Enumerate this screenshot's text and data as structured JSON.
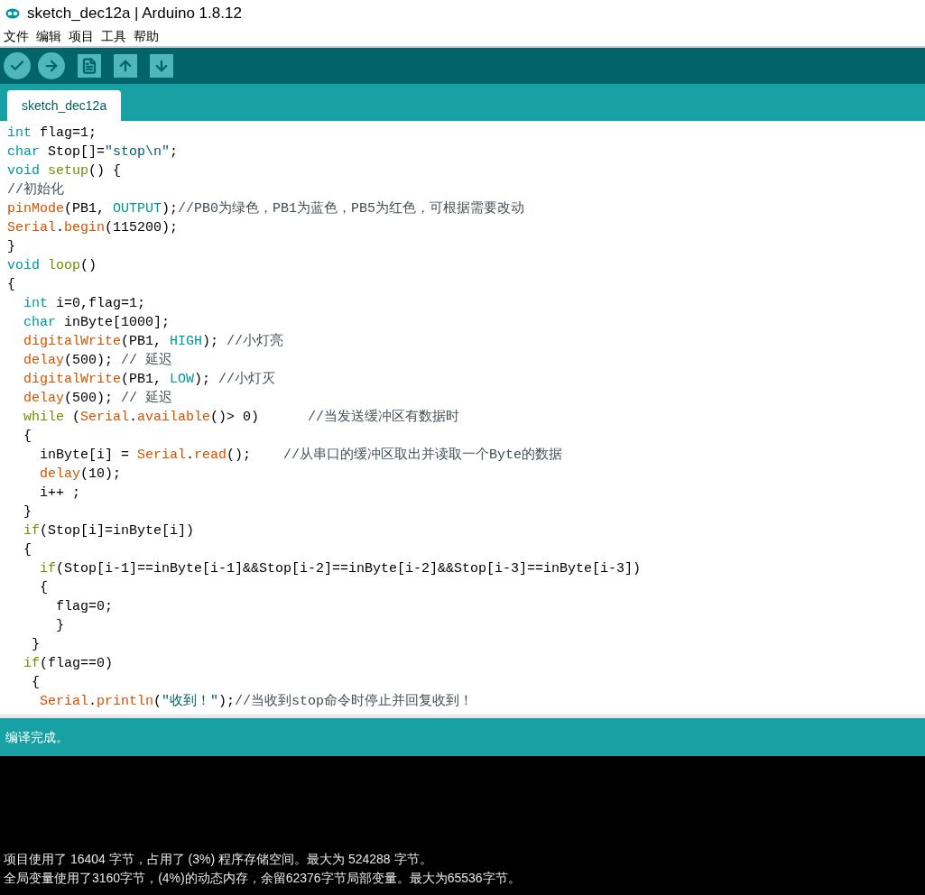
{
  "window": {
    "title": "sketch_dec12a | Arduino 1.8.12"
  },
  "menu": [
    "文件",
    "编辑",
    "项目",
    "工具",
    "帮助"
  ],
  "toolbar": [
    {
      "kind": "verify"
    },
    {
      "kind": "upload"
    },
    {
      "kind": "new"
    },
    {
      "kind": "open"
    },
    {
      "kind": "save"
    }
  ],
  "tabs": [
    {
      "label": "sketch_dec12a",
      "selected": true
    }
  ],
  "code_lines": [
    [
      {
        "kind": "type",
        "text": "int"
      },
      {
        "kind": "plain",
        "text": " flag=1;"
      }
    ],
    [
      {
        "kind": "type",
        "text": "char"
      },
      {
        "kind": "plain",
        "text": " Stop[]="
      },
      {
        "kind": "string",
        "text": "\"stop\\n\""
      },
      {
        "kind": "plain",
        "text": ";"
      }
    ],
    [
      {
        "kind": "type",
        "text": "void"
      },
      {
        "kind": "keyword",
        "text": " setup"
      },
      {
        "kind": "plain",
        "text": "() {"
      }
    ],
    [
      {
        "kind": "comment",
        "text": "//初始化"
      }
    ],
    [
      {
        "kind": "function",
        "text": "pinMode"
      },
      {
        "kind": "plain",
        "text": "(PB1, "
      },
      {
        "kind": "type",
        "text": "OUTPUT"
      },
      {
        "kind": "plain",
        "text": ");"
      },
      {
        "kind": "comment",
        "text": "//PB0为绿色，PB1为蓝色，PB5为红色，可根据需要改动"
      }
    ],
    [
      {
        "kind": "function",
        "text": "Serial"
      },
      {
        "kind": "plain",
        "text": "."
      },
      {
        "kind": "function",
        "text": "begin"
      },
      {
        "kind": "plain",
        "text": "(115200);"
      }
    ],
    [
      {
        "kind": "plain",
        "text": "}"
      }
    ],
    [
      {
        "kind": "type",
        "text": "void"
      },
      {
        "kind": "keyword",
        "text": " loop"
      },
      {
        "kind": "plain",
        "text": "()"
      }
    ],
    [
      {
        "kind": "plain",
        "text": "{"
      }
    ],
    [
      {
        "kind": "type",
        "text": "  int"
      },
      {
        "kind": "plain",
        "text": " i=0,flag=1;"
      }
    ],
    [
      {
        "kind": "type",
        "text": "  char"
      },
      {
        "kind": "plain",
        "text": " inByte[1000];"
      }
    ],
    [
      {
        "kind": "function",
        "text": "  digitalWrite"
      },
      {
        "kind": "plain",
        "text": "(PB1, "
      },
      {
        "kind": "type",
        "text": "HIGH"
      },
      {
        "kind": "plain",
        "text": "); "
      },
      {
        "kind": "comment",
        "text": "//小灯亮"
      }
    ],
    [
      {
        "kind": "function",
        "text": "  delay"
      },
      {
        "kind": "plain",
        "text": "(500); "
      },
      {
        "kind": "comment",
        "text": "// 延迟"
      }
    ],
    [
      {
        "kind": "function",
        "text": "  digitalWrite"
      },
      {
        "kind": "plain",
        "text": "(PB1, "
      },
      {
        "kind": "type",
        "text": "LOW"
      },
      {
        "kind": "plain",
        "text": "); "
      },
      {
        "kind": "comment",
        "text": "//小灯灭"
      }
    ],
    [
      {
        "kind": "function",
        "text": "  delay"
      },
      {
        "kind": "plain",
        "text": "(500); "
      },
      {
        "kind": "comment",
        "text": "// 延迟"
      }
    ],
    [
      {
        "kind": "keyword",
        "text": "  while"
      },
      {
        "kind": "plain",
        "text": " ("
      },
      {
        "kind": "function",
        "text": "Serial"
      },
      {
        "kind": "plain",
        "text": "."
      },
      {
        "kind": "function",
        "text": "available"
      },
      {
        "kind": "plain",
        "text": "()> 0)      "
      },
      {
        "kind": "comment",
        "text": "//当发送缓冲区有数据时"
      }
    ],
    [
      {
        "kind": "plain",
        "text": "  {"
      }
    ],
    [
      {
        "kind": "plain",
        "text": "    inByte[i] = "
      },
      {
        "kind": "function",
        "text": "Serial"
      },
      {
        "kind": "plain",
        "text": "."
      },
      {
        "kind": "function",
        "text": "read"
      },
      {
        "kind": "plain",
        "text": "();    "
      },
      {
        "kind": "comment",
        "text": "//从串口的缓冲区取出并读取一个Byte的数据"
      }
    ],
    [
      {
        "kind": "function",
        "text": "    delay"
      },
      {
        "kind": "plain",
        "text": "(10);"
      }
    ],
    [
      {
        "kind": "plain",
        "text": "    i++ ;"
      }
    ],
    [
      {
        "kind": "plain",
        "text": "  }"
      }
    ],
    [
      {
        "kind": "keyword",
        "text": "  if"
      },
      {
        "kind": "plain",
        "text": "(Stop[i]=inByte[i])"
      }
    ],
    [
      {
        "kind": "plain",
        "text": "  {"
      }
    ],
    [
      {
        "kind": "keyword",
        "text": "    if"
      },
      {
        "kind": "plain",
        "text": "(Stop[i-1]==inByte[i-1]&&Stop[i-2]==inByte[i-2]&&Stop[i-3]==inByte[i-3])"
      }
    ],
    [
      {
        "kind": "plain",
        "text": "    {"
      }
    ],
    [
      {
        "kind": "plain",
        "text": "      flag=0;"
      }
    ],
    [
      {
        "kind": "plain",
        "text": "      }"
      }
    ],
    [
      {
        "kind": "plain",
        "text": "   }"
      }
    ],
    [
      {
        "kind": "keyword",
        "text": "  if"
      },
      {
        "kind": "plain",
        "text": "(flag==0)"
      }
    ],
    [
      {
        "kind": "plain",
        "text": "   {"
      }
    ],
    [
      {
        "kind": "function",
        "text": "    Serial"
      },
      {
        "kind": "plain",
        "text": "."
      },
      {
        "kind": "function",
        "text": "println"
      },
      {
        "kind": "plain",
        "text": "("
      },
      {
        "kind": "string",
        "text": "\"收到！\""
      },
      {
        "kind": "plain",
        "text": ");"
      },
      {
        "kind": "comment",
        "text": "//当收到stop命令时停止并回复收到！"
      }
    ]
  ],
  "status": "编译完成。",
  "console": [
    "项目使用了 16404 字节，占用了 (3%) 程序存储空间。最大为 524288 字节。",
    "全局变量使用了3160字节，(4%)的动态内存，余留62376字节局部变量。最大为65536字节。"
  ]
}
